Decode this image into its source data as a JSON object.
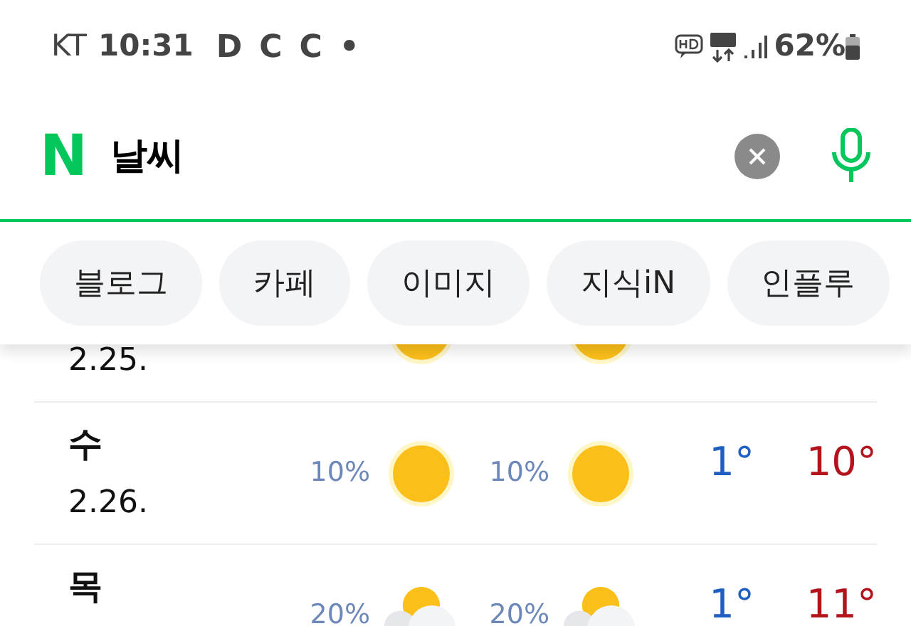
{
  "status_bar": {
    "carrier": "KT",
    "time": "10:31",
    "notifications": [
      "D",
      "C",
      "C",
      "•"
    ],
    "battery": "62%"
  },
  "search": {
    "logo": "N",
    "query": "날씨"
  },
  "chips": [
    {
      "label": "블로그"
    },
    {
      "label": "카페"
    },
    {
      "label": "이미지"
    },
    {
      "label": "지식iN"
    },
    {
      "label": "인플루"
    }
  ],
  "forecast": [
    {
      "date": "2.25.",
      "am_weather": {
        "kind": "sun"
      },
      "pm_weather": {
        "kind": "sun"
      }
    },
    {
      "day": "수",
      "date": "2.26.",
      "am_precip": "10%",
      "am_weather": {
        "kind": "sun"
      },
      "pm_precip": "10%",
      "pm_weather": {
        "kind": "sun"
      },
      "low": "1°",
      "high": "10°"
    },
    {
      "day": "목",
      "am_precip": "20%",
      "am_weather": {
        "kind": "partly-cloudy"
      },
      "pm_precip": "20%",
      "pm_weather": {
        "kind": "partly-cloudy"
      },
      "low": "1°",
      "high": "11°"
    }
  ]
}
